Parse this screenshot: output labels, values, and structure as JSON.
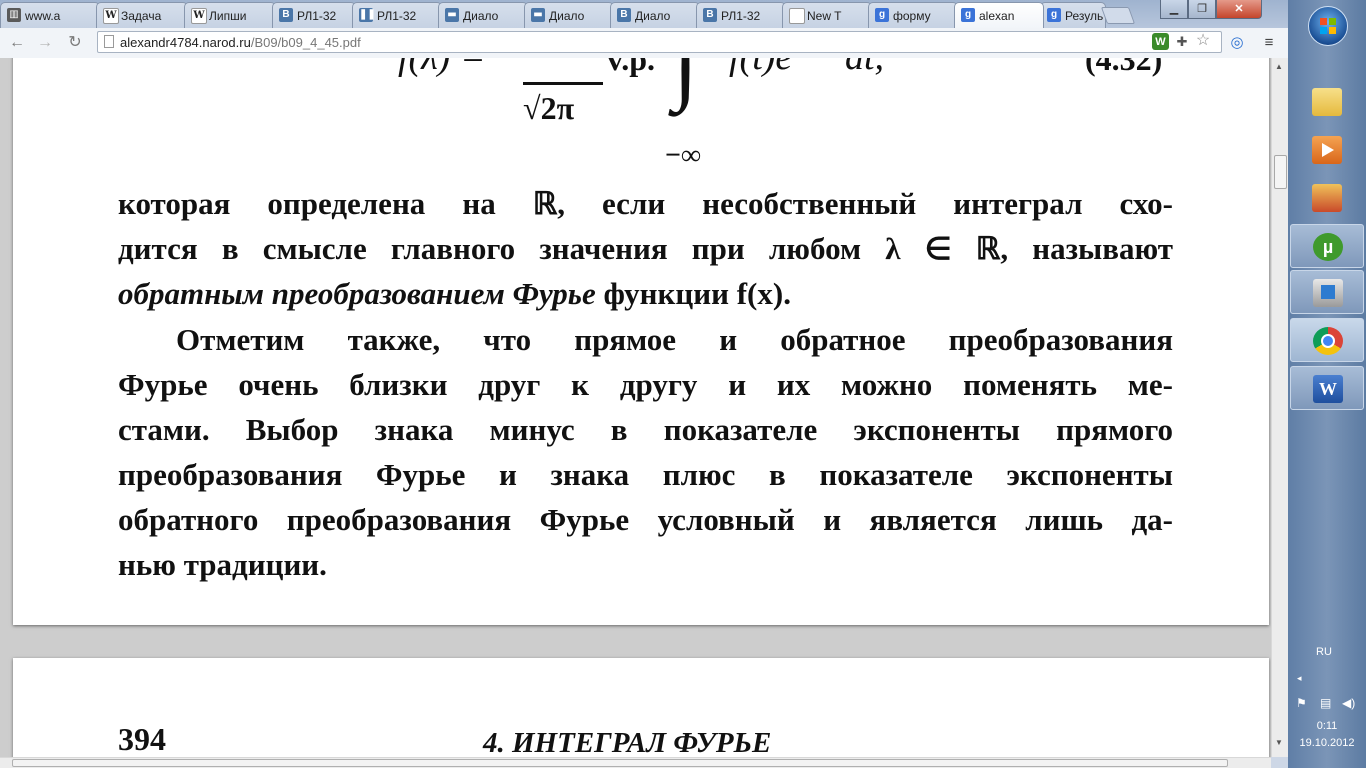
{
  "browser": {
    "tabs": [
      {
        "title": "www.a",
        "favicon": "book-icon"
      },
      {
        "title": "Задача",
        "favicon": "wikipedia-icon"
      },
      {
        "title": "Липши",
        "favicon": "wikipedia-icon"
      },
      {
        "title": "РЛ1-32",
        "favicon": "vk-icon"
      },
      {
        "title": "РЛ1-32",
        "favicon": "pause-icon"
      },
      {
        "title": "Диало",
        "favicon": "chat-icon"
      },
      {
        "title": "Диало",
        "favicon": "chat-icon"
      },
      {
        "title": "Диало",
        "favicon": "vk-icon"
      },
      {
        "title": "РЛ1-32",
        "favicon": "vk-icon"
      },
      {
        "title": "New T",
        "favicon": "page-icon"
      },
      {
        "title": "форму",
        "favicon": "google-icon"
      },
      {
        "title": "alexan",
        "favicon": "google-icon",
        "active": true
      },
      {
        "title": "Резуль",
        "favicon": "google-icon"
      }
    ],
    "url_host": "alexandr4784.narod.ru",
    "url_path": "/B09/b09_4_45.pdf"
  },
  "document": {
    "formula": {
      "lhs": "f(λ) =",
      "fraction_den": "√2π",
      "vp": "v.p.",
      "integrand_start": "f(t)e",
      "integrand_end": "dt,",
      "lower_limit": "−∞",
      "equation_number": "(4.32)"
    },
    "paragraph1": {
      "line1": "которая определена на ℝ, если несобственный интеграл схо-",
      "line2": "дится в смысле главного значения при любом λ ∈ ℝ, называют",
      "line3_em": "обратным преобразованием Фурье",
      "line3_rest": " функции f(x)."
    },
    "paragraph2": [
      "Отметим также, что прямое и обратное преобразования",
      "Фурье очень близки друг к другу и их можно поменять ме-",
      "стами.  Выбор знака минус в показателе экспоненты прямого",
      "преобразования Фурье и знака плюс в показателе экспоненты",
      "обратного преобразования Фурье условный и является лишь да-",
      "нью традиции."
    ],
    "page_number": "394",
    "running_head": "4. ИНТЕГРАЛ ФУРЬЕ"
  },
  "taskbar": {
    "pinned": [
      "windows-explorer-icon",
      "media-player-icon",
      "paint-icon",
      "utorrent-icon",
      "computer-icon",
      "chrome-icon",
      "word-icon"
    ],
    "language": "RU",
    "time": "0:11",
    "date": "19.10.2012"
  },
  "colors": {
    "taskbar": "#6e8ab0",
    "active_tab": "#ffffff",
    "chrome_frame": "#b7c6dc"
  }
}
